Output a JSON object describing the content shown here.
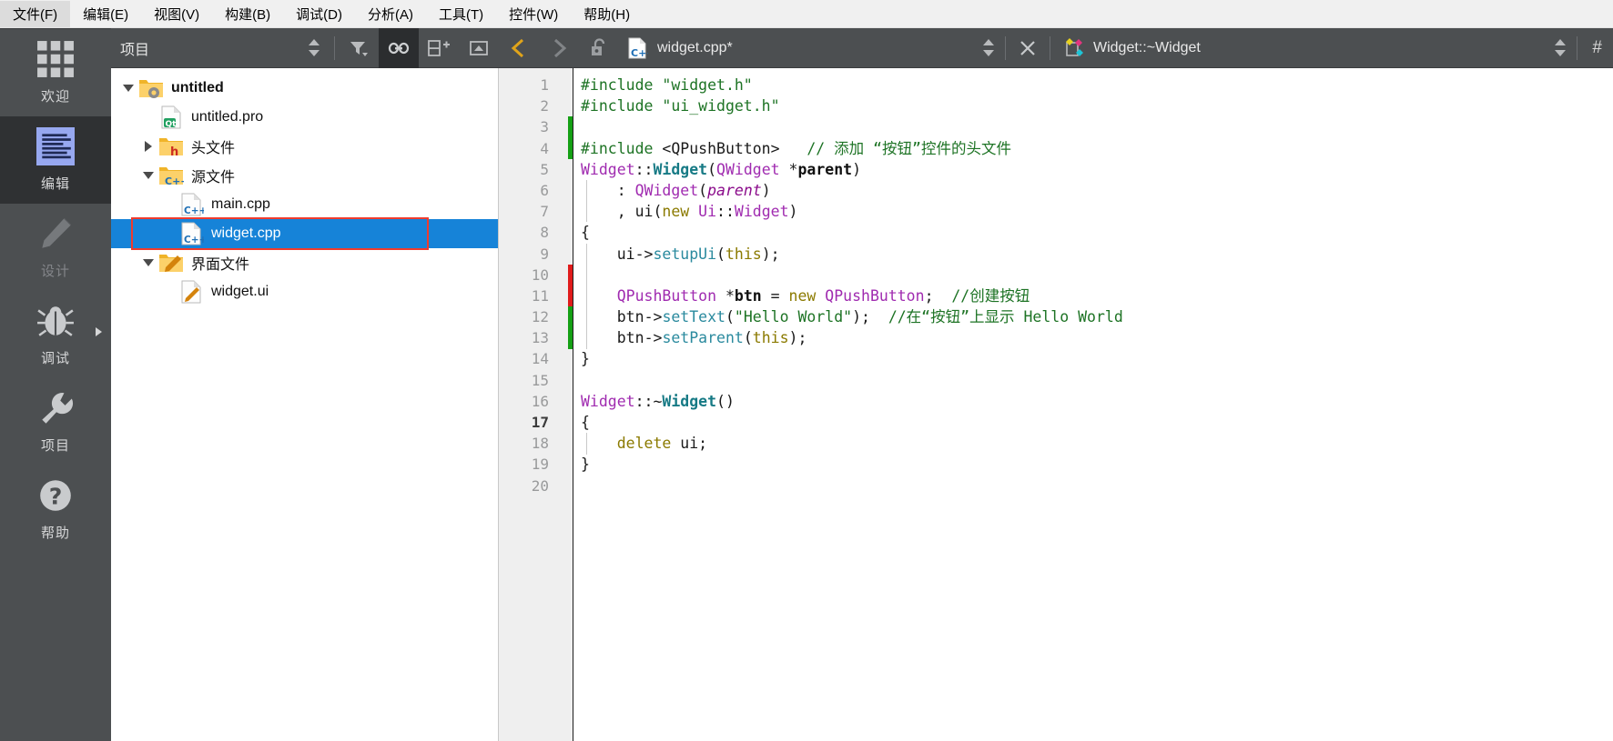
{
  "menubar": {
    "items": [
      {
        "label": "文件(F)",
        "name": "menu-file"
      },
      {
        "label": "编辑(E)",
        "name": "menu-edit"
      },
      {
        "label": "视图(V)",
        "name": "menu-view"
      },
      {
        "label": "构建(B)",
        "name": "menu-build"
      },
      {
        "label": "调试(D)",
        "name": "menu-debug"
      },
      {
        "label": "分析(A)",
        "name": "menu-analyze"
      },
      {
        "label": "工具(T)",
        "name": "menu-tools"
      },
      {
        "label": "控件(W)",
        "name": "menu-window"
      },
      {
        "label": "帮助(H)",
        "name": "menu-help"
      }
    ]
  },
  "modebar": {
    "items": [
      {
        "label": "欢迎",
        "icon": "grid-icon",
        "state": "normal"
      },
      {
        "label": "编辑",
        "icon": "edit-lines-icon",
        "state": "active"
      },
      {
        "label": "设计",
        "icon": "pencil-icon",
        "state": "disabled"
      },
      {
        "label": "调试",
        "icon": "bug-icon",
        "state": "normal",
        "arrow": true
      },
      {
        "label": "项目",
        "icon": "wrench-icon",
        "state": "normal"
      },
      {
        "label": "帮助",
        "icon": "question-circle-icon",
        "state": "normal"
      }
    ]
  },
  "left_panel": {
    "combo_label": "项目",
    "buttons": [
      {
        "name": "filter-button",
        "icon": "filter-icon",
        "checked": false
      },
      {
        "name": "sync-with-editor-button",
        "icon": "link-icon",
        "checked": true
      },
      {
        "name": "split-button",
        "icon": "split-add-icon",
        "checked": false
      },
      {
        "name": "close-sidebar-button",
        "icon": "collapse-icon",
        "checked": false
      }
    ],
    "tree": [
      {
        "label": "untitled",
        "icon": "project-folder-icon",
        "depth": 0,
        "twisty": "open",
        "bold": true,
        "selected": false
      },
      {
        "label": "untitled.pro",
        "icon": "qt-pro-file-icon",
        "depth": 1,
        "twisty": "none",
        "bold": false,
        "selected": false
      },
      {
        "label": "头文件",
        "icon": "folder-h-icon",
        "depth": 1,
        "twisty": "closed",
        "bold": false,
        "selected": false
      },
      {
        "label": "源文件",
        "icon": "folder-cpp-icon",
        "depth": 1,
        "twisty": "open",
        "bold": false,
        "selected": false
      },
      {
        "label": "main.cpp",
        "icon": "cpp-file-icon",
        "depth": 2,
        "twisty": "none",
        "bold": false,
        "selected": false
      },
      {
        "label": "widget.cpp",
        "icon": "cpp-file-icon",
        "depth": 2,
        "twisty": "none",
        "bold": false,
        "selected": true,
        "highlight_box": true
      },
      {
        "label": "界面文件",
        "icon": "folder-ui-icon",
        "depth": 1,
        "twisty": "open",
        "bold": false,
        "selected": false
      },
      {
        "label": "widget.ui",
        "icon": "ui-file-icon",
        "depth": 2,
        "twisty": "none",
        "bold": false,
        "selected": false
      }
    ],
    "highlight_color": "#ef3b2d",
    "selection_color": "#1683d8"
  },
  "editor": {
    "back_label": "‹",
    "forward_label": "›",
    "lock_icon": "unlock-icon",
    "document_name": "widget.cpp*",
    "document_icon": "cpp-file-icon",
    "symbol_name": "Widget::~Widget",
    "symbol_icon": "symbol-destructor-icon",
    "close_label": "✕",
    "hash_label": "#",
    "cursor_line": 17,
    "line_count": 20,
    "gutter_marks": [
      {
        "line": 3,
        "color": "#15a015"
      },
      {
        "line": 4,
        "color": "#15a015"
      },
      {
        "line": 10,
        "color": "#e01b1b"
      },
      {
        "line": 11,
        "color": "#e01b1b"
      },
      {
        "line": 12,
        "color": "#15a015"
      },
      {
        "line": 13,
        "color": "#15a015"
      }
    ],
    "fold_lines": [
      7,
      16
    ],
    "lines": [
      {
        "n": 1,
        "tokens": [
          {
            "t": "#include ",
            "c": "k-pre"
          },
          {
            "t": "\"widget.h\"",
            "c": "k-str"
          }
        ]
      },
      {
        "n": 2,
        "tokens": [
          {
            "t": "#include ",
            "c": "k-pre"
          },
          {
            "t": "\"ui_widget.h\"",
            "c": "k-str"
          }
        ]
      },
      {
        "n": 3,
        "tokens": []
      },
      {
        "n": 4,
        "tokens": [
          {
            "t": "#include ",
            "c": "k-pre"
          },
          {
            "t": "<QPushButton>",
            "c": "k-plain"
          },
          {
            "t": "   ",
            "c": "k-plain"
          },
          {
            "t": "// 添加 “按钮”控件的头文件",
            "c": "k-cmt"
          }
        ]
      },
      {
        "n": 5,
        "tokens": [
          {
            "t": "Widget",
            "c": "k-ns"
          },
          {
            "t": "::",
            "c": "k-plain"
          },
          {
            "t": "Widget",
            "c": "k-fn"
          },
          {
            "t": "(",
            "c": "k-plain"
          },
          {
            "t": "QWidget",
            "c": "k-ns"
          },
          {
            "t": " *",
            "c": "k-plain"
          },
          {
            "t": "parent",
            "c": "k-bold"
          },
          {
            "t": ")",
            "c": "k-plain"
          }
        ]
      },
      {
        "n": 6,
        "tokens": [
          {
            "t": "    : ",
            "c": "k-plain"
          },
          {
            "t": "QWidget",
            "c": "k-ns"
          },
          {
            "t": "(",
            "c": "k-plain"
          },
          {
            "t": "parent",
            "c": "k-param"
          },
          {
            "t": ")",
            "c": "k-plain"
          }
        ]
      },
      {
        "n": 7,
        "tokens": [
          {
            "t": "    , ",
            "c": "k-plain"
          },
          {
            "t": "ui",
            "c": "k-plain"
          },
          {
            "t": "(",
            "c": "k-plain"
          },
          {
            "t": "new",
            "c": "k-kw"
          },
          {
            "t": " ",
            "c": "k-plain"
          },
          {
            "t": "Ui",
            "c": "k-ns"
          },
          {
            "t": "::",
            "c": "k-plain"
          },
          {
            "t": "Widget",
            "c": "k-ns"
          },
          {
            "t": ")",
            "c": "k-plain"
          }
        ]
      },
      {
        "n": 8,
        "tokens": [
          {
            "t": "{",
            "c": "k-plain"
          }
        ]
      },
      {
        "n": 9,
        "tokens": [
          {
            "t": "    ",
            "c": "k-plain"
          },
          {
            "t": "ui",
            "c": "k-plain"
          },
          {
            "t": "->",
            "c": "k-plain"
          },
          {
            "t": "setupUi",
            "c": "k-call"
          },
          {
            "t": "(",
            "c": "k-plain"
          },
          {
            "t": "this",
            "c": "k-kw"
          },
          {
            "t": ");",
            "c": "k-plain"
          }
        ]
      },
      {
        "n": 10,
        "tokens": []
      },
      {
        "n": 11,
        "tokens": [
          {
            "t": "    ",
            "c": "k-plain"
          },
          {
            "t": "QPushButton",
            "c": "k-ns"
          },
          {
            "t": " *",
            "c": "k-plain"
          },
          {
            "t": "btn",
            "c": "k-bold"
          },
          {
            "t": " = ",
            "c": "k-plain"
          },
          {
            "t": "new",
            "c": "k-kw"
          },
          {
            "t": " ",
            "c": "k-plain"
          },
          {
            "t": "QPushButton",
            "c": "k-ns"
          },
          {
            "t": ";  ",
            "c": "k-plain"
          },
          {
            "t": "//创建按钮",
            "c": "k-cmt"
          }
        ]
      },
      {
        "n": 12,
        "tokens": [
          {
            "t": "    ",
            "c": "k-plain"
          },
          {
            "t": "btn",
            "c": "k-plain"
          },
          {
            "t": "->",
            "c": "k-plain"
          },
          {
            "t": "setText",
            "c": "k-call"
          },
          {
            "t": "(",
            "c": "k-plain"
          },
          {
            "t": "\"Hello World\"",
            "c": "k-str"
          },
          {
            "t": ");  ",
            "c": "k-plain"
          },
          {
            "t": "//在“按钮”上显示 Hello World",
            "c": "k-cmt"
          }
        ]
      },
      {
        "n": 13,
        "tokens": [
          {
            "t": "    ",
            "c": "k-plain"
          },
          {
            "t": "btn",
            "c": "k-plain"
          },
          {
            "t": "->",
            "c": "k-plain"
          },
          {
            "t": "setParent",
            "c": "k-call"
          },
          {
            "t": "(",
            "c": "k-plain"
          },
          {
            "t": "this",
            "c": "k-kw"
          },
          {
            "t": ");",
            "c": "k-plain"
          }
        ]
      },
      {
        "n": 14,
        "tokens": [
          {
            "t": "}",
            "c": "k-plain"
          }
        ]
      },
      {
        "n": 15,
        "tokens": []
      },
      {
        "n": 16,
        "tokens": [
          {
            "t": "Widget",
            "c": "k-ns"
          },
          {
            "t": "::~",
            "c": "k-plain"
          },
          {
            "t": "Widget",
            "c": "k-fn"
          },
          {
            "t": "()",
            "c": "k-plain"
          }
        ]
      },
      {
        "n": 17,
        "tokens": [
          {
            "t": "{",
            "c": "k-plain"
          }
        ]
      },
      {
        "n": 18,
        "tokens": [
          {
            "t": "    ",
            "c": "k-plain"
          },
          {
            "t": "delete",
            "c": "k-kw"
          },
          {
            "t": " ",
            "c": "k-plain"
          },
          {
            "t": "ui",
            "c": "k-plain"
          },
          {
            "t": ";",
            "c": "k-plain"
          }
        ]
      },
      {
        "n": 19,
        "tokens": [
          {
            "t": "}",
            "c": "k-plain"
          }
        ]
      },
      {
        "n": 20,
        "tokens": []
      }
    ]
  }
}
